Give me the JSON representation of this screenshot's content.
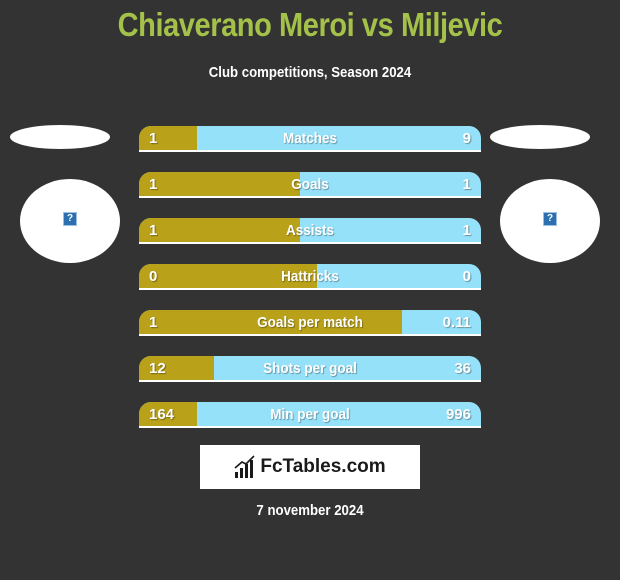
{
  "header": {
    "title": "Chiaverano Meroi vs Miljevic",
    "subtitle": "Club competitions, Season 2024"
  },
  "players": {
    "left": {
      "logo_icon": "broken-image-icon"
    },
    "right": {
      "logo_icon": "broken-image-icon"
    }
  },
  "colors": {
    "title": "#a4c14a",
    "left_bar": "#b9a11a",
    "right_bar": "#96e1fa",
    "background": "#333333"
  },
  "stats": [
    {
      "label": "Matches",
      "left": "1",
      "right": "9",
      "left_share": 0.17
    },
    {
      "label": "Goals",
      "left": "1",
      "right": "1",
      "left_share": 0.47
    },
    {
      "label": "Assists",
      "left": "1",
      "right": "1",
      "left_share": 0.47
    },
    {
      "label": "Hattricks",
      "left": "0",
      "right": "0",
      "left_share": 0.52
    },
    {
      "label": "Goals per match",
      "left": "1",
      "right": "0.11",
      "left_share": 0.77
    },
    {
      "label": "Shots per goal",
      "left": "12",
      "right": "36",
      "left_share": 0.22
    },
    {
      "label": "Min per goal",
      "left": "164",
      "right": "996",
      "left_share": 0.17
    }
  ],
  "brand": {
    "name": "FcTables.com",
    "icon": "bar-chart-icon"
  },
  "footer": {
    "date": "7 november 2024"
  }
}
